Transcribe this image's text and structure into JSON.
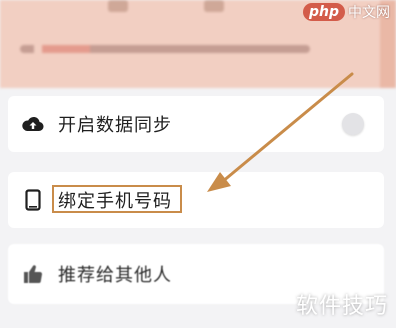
{
  "watermarks": {
    "top_brand": "php",
    "top_site": "中文网",
    "bottom": "软件技巧"
  },
  "menu": {
    "items": [
      {
        "label": "开启数据同步",
        "icon": "cloud-upload-icon",
        "control": "toggle",
        "toggle_on": false
      },
      {
        "label": "绑定手机号码",
        "icon": "phone-icon",
        "highlighted": true
      },
      {
        "label": "推荐给其他人",
        "icon": "thumbs-up-icon"
      }
    ]
  },
  "colors": {
    "annotation": "#c98c4a",
    "banner": "#f2cfc2",
    "background": "#f3f3f5"
  }
}
